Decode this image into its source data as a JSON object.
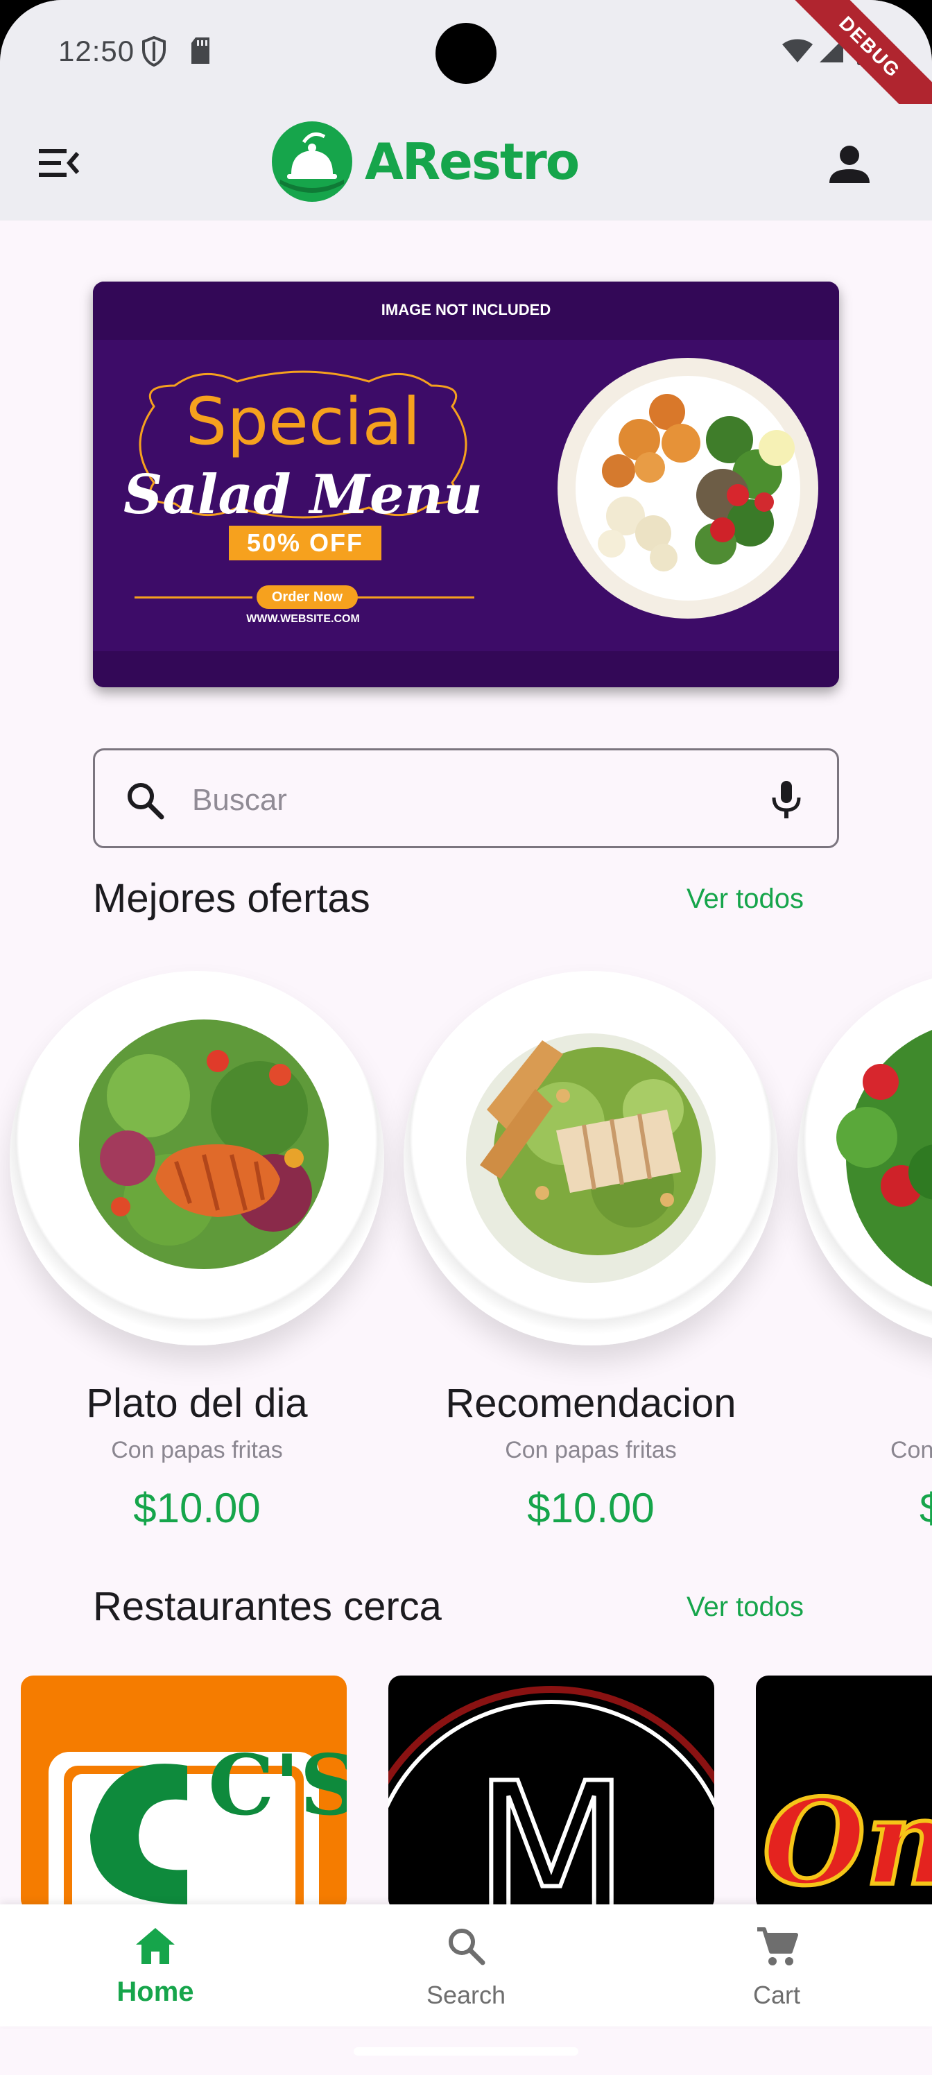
{
  "status_bar": {
    "time": "12:50",
    "debug_label": "DEBUG"
  },
  "app_bar": {
    "logo_text": "ARestro"
  },
  "banner": {
    "note": "IMAGE NOT INCLUDED",
    "headline_1": "Special",
    "headline_2": "Salad Menu",
    "discount": "50% OFF",
    "cta": "Order Now",
    "website": "WWW.WEBSITE.COM"
  },
  "search": {
    "placeholder": "Buscar"
  },
  "offers_section": {
    "title": "Mejores ofertas",
    "link": "Ver todos"
  },
  "offers": [
    {
      "name": "Plato del dia",
      "desc": "Con papas fritas",
      "price": "$10.00"
    },
    {
      "name": "Recomendacion",
      "desc": "Con papas fritas",
      "price": "$10.00"
    },
    {
      "name": "",
      "desc": "Con",
      "price": "$"
    }
  ],
  "restaurants_section": {
    "title": "Restaurantes cerca",
    "link": "Ver todos"
  },
  "restaurants": [
    {
      "logo_text": "C'S"
    },
    {
      "logo_text": "M"
    },
    {
      "logo_text": "One"
    }
  ],
  "bottom_nav": [
    {
      "label": "Home",
      "active": true
    },
    {
      "label": "Search",
      "active": false
    },
    {
      "label": "Cart",
      "active": false
    }
  ],
  "colors": {
    "brand_green": "#16a54b",
    "banner_purple": "#3d0c68",
    "banner_orange": "#f6a11e",
    "background": "#fcf6fc"
  }
}
